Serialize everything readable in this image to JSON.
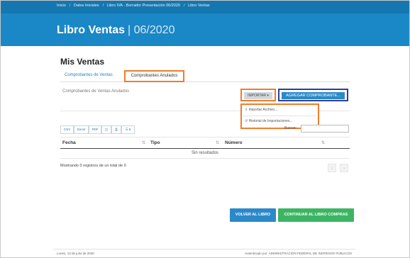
{
  "breadcrumb": [
    "Inicio",
    "Datos Iniciales",
    "Libro IVA - Borrador Presentación 06/2020",
    "Libro Ventas"
  ],
  "page": {
    "title": "Libro Ventas",
    "period": "| 06/2020"
  },
  "section": {
    "title": "Mis Ventas"
  },
  "tabs": [
    {
      "label": "Comprobantes de Ventas",
      "active": false
    },
    {
      "label": "Comprobantes Anulados",
      "active": true
    }
  ],
  "panel": {
    "subtitle": "Comprobantes de Ventas Anulados"
  },
  "actions": {
    "importar_label": "IMPORTAR ▾",
    "agregar_label": "AGREGAR COMPROBANTE..."
  },
  "dropdown": {
    "items": [
      {
        "label": "Importar Archivo...",
        "icon": "upload-icon"
      },
      {
        "label": "Historial de Importaciones...",
        "icon": "history-icon"
      }
    ]
  },
  "toolbar": {
    "csv": "CSV",
    "excel": "Excel",
    "pdf": "PDF",
    "columns_icon": "columns-icon",
    "print_icon": "print-icon",
    "list_icon": "list-icon",
    "list_count": "5"
  },
  "search": {
    "label": "Buscar:",
    "value": "",
    "placeholder": ""
  },
  "table": {
    "columns": [
      "Fecha",
      "Tipo",
      "Número"
    ],
    "empty_message": "Sin resultados",
    "info": "Mostrando 0 registros de un total de 0"
  },
  "pagination": {
    "prev": "‹",
    "next": "›"
  },
  "buttons": {
    "volver": "VOLVER AL LIBRO",
    "continuar": "CONTINUAR AL LIBRO COMPRAS"
  },
  "footer": {
    "date": "Lunes, 13 de julio de 2020",
    "auth": "Autenticado por: ADMINISTRACIÓN FEDERAL DE INGRESOS PÚBLICOS"
  },
  "colors": {
    "banner": "#1a87c6",
    "highlight_orange": "#f07c2a",
    "highlight_navy": "#2d3f94",
    "primary": "#2b89c9",
    "success": "#3cb563"
  }
}
